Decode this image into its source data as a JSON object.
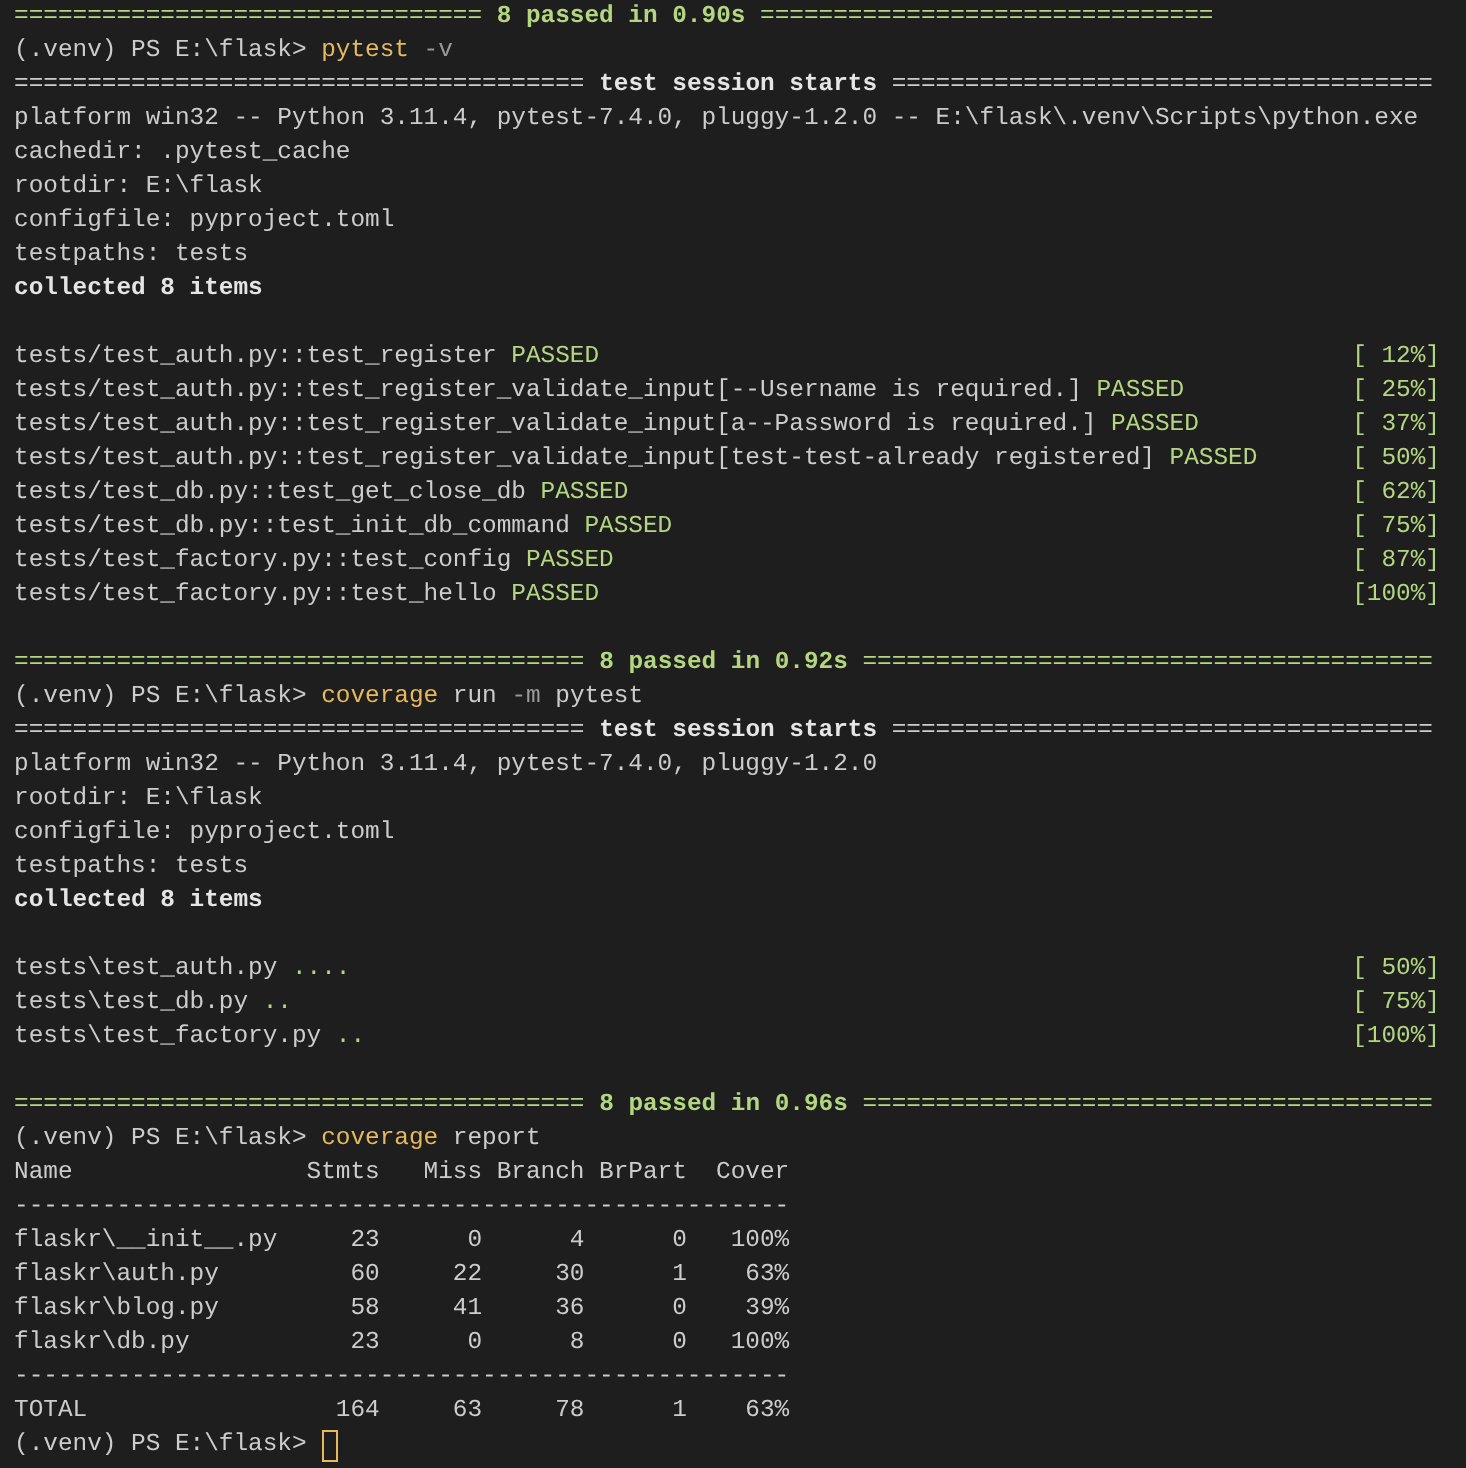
{
  "terminal": {
    "lines": [
      {
        "kind": "text",
        "segments": [
          {
            "text": "================================ ",
            "kind": "pass_rule"
          },
          {
            "text": "8 passed in 0.90s",
            "kind": "summary"
          },
          {
            "text": " ===============================",
            "kind": "pass_rule"
          }
        ]
      },
      {
        "kind": "text",
        "segments": [
          {
            "text": "(.venv) PS E:\\flask> ",
            "kind": "output"
          },
          {
            "text": "pytest",
            "kind": "command"
          },
          {
            "text": " -v",
            "kind": "option"
          }
        ]
      },
      {
        "kind": "text",
        "segments": [
          {
            "text": "======================================= ",
            "kind": "output"
          },
          {
            "text": "test session starts",
            "kind": "heading"
          },
          {
            "text": " =====================================",
            "kind": "output"
          }
        ]
      },
      {
        "kind": "text",
        "segments": [
          {
            "text": "platform win32 -- Python 3.11.4, pytest-7.4.0, pluggy-1.2.0 -- E:\\flask\\.venv\\Scripts\\python.exe",
            "kind": "output"
          }
        ]
      },
      {
        "kind": "text",
        "segments": [
          {
            "text": "cachedir: .pytest_cache",
            "kind": "output"
          }
        ]
      },
      {
        "kind": "text",
        "segments": [
          {
            "text": "rootdir: E:\\flask",
            "kind": "output"
          }
        ]
      },
      {
        "kind": "text",
        "segments": [
          {
            "text": "configfile: pyproject.toml",
            "kind": "output"
          }
        ]
      },
      {
        "kind": "text",
        "segments": [
          {
            "text": "testpaths: tests",
            "kind": "output"
          }
        ]
      },
      {
        "kind": "text",
        "segments": [
          {
            "text": "collected 8 items",
            "kind": "heading"
          }
        ]
      },
      {
        "kind": "blank"
      },
      {
        "kind": "text",
        "segments": [
          {
            "text": "tests/test_auth.py::test_register ",
            "kind": "output"
          },
          {
            "text": "PASSED",
            "kind": "status"
          }
        ],
        "right": "[ 12%]"
      },
      {
        "kind": "text",
        "segments": [
          {
            "text": "tests/test_auth.py::test_register_validate_input[--Username is required.] ",
            "kind": "output"
          },
          {
            "text": "PASSED",
            "kind": "status"
          }
        ],
        "right": "[ 25%]"
      },
      {
        "kind": "text",
        "segments": [
          {
            "text": "tests/test_auth.py::test_register_validate_input[a--Password is required.] ",
            "kind": "output"
          },
          {
            "text": "PASSED",
            "kind": "status"
          }
        ],
        "right": "[ 37%]"
      },
      {
        "kind": "text",
        "segments": [
          {
            "text": "tests/test_auth.py::test_register_validate_input[test-test-already registered] ",
            "kind": "output"
          },
          {
            "text": "PASSED",
            "kind": "status"
          }
        ],
        "right": "[ 50%]"
      },
      {
        "kind": "text",
        "segments": [
          {
            "text": "tests/test_db.py::test_get_close_db ",
            "kind": "output"
          },
          {
            "text": "PASSED",
            "kind": "status"
          }
        ],
        "right": "[ 62%]"
      },
      {
        "kind": "text",
        "segments": [
          {
            "text": "tests/test_db.py::test_init_db_command ",
            "kind": "output"
          },
          {
            "text": "PASSED",
            "kind": "status"
          }
        ],
        "right": "[ 75%]"
      },
      {
        "kind": "text",
        "segments": [
          {
            "text": "tests/test_factory.py::test_config ",
            "kind": "output"
          },
          {
            "text": "PASSED",
            "kind": "status"
          }
        ],
        "right": "[ 87%]"
      },
      {
        "kind": "text",
        "segments": [
          {
            "text": "tests/test_factory.py::test_hello ",
            "kind": "output"
          },
          {
            "text": "PASSED",
            "kind": "status"
          }
        ],
        "right": "[100%]"
      },
      {
        "kind": "blank"
      },
      {
        "kind": "text",
        "segments": [
          {
            "text": "======================================= ",
            "kind": "pass_rule"
          },
          {
            "text": "8 passed in 0.92s",
            "kind": "summary"
          },
          {
            "text": " =======================================",
            "kind": "pass_rule"
          }
        ]
      },
      {
        "kind": "text",
        "segments": [
          {
            "text": "(.venv) PS E:\\flask> ",
            "kind": "output"
          },
          {
            "text": "coverage",
            "kind": "command"
          },
          {
            "text": " run ",
            "kind": "output"
          },
          {
            "text": "-m",
            "kind": "option"
          },
          {
            "text": " pytest",
            "kind": "output"
          }
        ]
      },
      {
        "kind": "text",
        "segments": [
          {
            "text": "======================================= ",
            "kind": "output"
          },
          {
            "text": "test session starts",
            "kind": "heading"
          },
          {
            "text": " =====================================",
            "kind": "output"
          }
        ]
      },
      {
        "kind": "text",
        "segments": [
          {
            "text": "platform win32 -- Python 3.11.4, pytest-7.4.0, pluggy-1.2.0",
            "kind": "output"
          }
        ]
      },
      {
        "kind": "text",
        "segments": [
          {
            "text": "rootdir: E:\\flask",
            "kind": "output"
          }
        ]
      },
      {
        "kind": "text",
        "segments": [
          {
            "text": "configfile: pyproject.toml",
            "kind": "output"
          }
        ]
      },
      {
        "kind": "text",
        "segments": [
          {
            "text": "testpaths: tests",
            "kind": "output"
          }
        ]
      },
      {
        "kind": "text",
        "segments": [
          {
            "text": "collected 8 items",
            "kind": "heading"
          }
        ]
      },
      {
        "kind": "blank"
      },
      {
        "kind": "text",
        "segments": [
          {
            "text": "tests\\test_auth.py ",
            "kind": "output"
          },
          {
            "text": "....",
            "kind": "status"
          }
        ],
        "right": "[ 50%]"
      },
      {
        "kind": "text",
        "segments": [
          {
            "text": "tests\\test_db.py ",
            "kind": "output"
          },
          {
            "text": "..",
            "kind": "status"
          }
        ],
        "right": "[ 75%]"
      },
      {
        "kind": "text",
        "segments": [
          {
            "text": "tests\\test_factory.py ",
            "kind": "output"
          },
          {
            "text": "..",
            "kind": "status"
          }
        ],
        "right": "[100%]"
      },
      {
        "kind": "blank"
      },
      {
        "kind": "text",
        "segments": [
          {
            "text": "======================================= ",
            "kind": "pass_rule"
          },
          {
            "text": "8 passed in 0.96s",
            "kind": "summary"
          },
          {
            "text": " =======================================",
            "kind": "pass_rule"
          }
        ]
      },
      {
        "kind": "text",
        "segments": [
          {
            "text": "(.venv) PS E:\\flask> ",
            "kind": "output"
          },
          {
            "text": "coverage",
            "kind": "command"
          },
          {
            "text": " report",
            "kind": "output"
          }
        ]
      },
      {
        "kind": "table_header",
        "cells": [
          "Name",
          "Stmts",
          "Miss",
          "Branch",
          "BrPart",
          "Cover"
        ]
      },
      {
        "kind": "rule",
        "text": "-----------------------------------------------------"
      },
      {
        "kind": "table_row",
        "cells": [
          "flaskr\\__init__.py",
          "23",
          "0",
          "4",
          "0",
          "100%"
        ]
      },
      {
        "kind": "table_row",
        "cells": [
          "flaskr\\auth.py",
          "60",
          "22",
          "30",
          "1",
          "63%"
        ]
      },
      {
        "kind": "table_row",
        "cells": [
          "flaskr\\blog.py",
          "58",
          "41",
          "36",
          "0",
          "39%"
        ]
      },
      {
        "kind": "table_row",
        "cells": [
          "flaskr\\db.py",
          "23",
          "0",
          "8",
          "0",
          "100%"
        ]
      },
      {
        "kind": "rule",
        "text": "-----------------------------------------------------"
      },
      {
        "kind": "table_row",
        "cells": [
          "TOTAL",
          "164",
          "63",
          "78",
          "1",
          "63%"
        ]
      },
      {
        "kind": "text",
        "segments": [
          {
            "text": "(.venv) PS E:\\flask> ",
            "kind": "output"
          }
        ],
        "cursor": true
      }
    ]
  }
}
